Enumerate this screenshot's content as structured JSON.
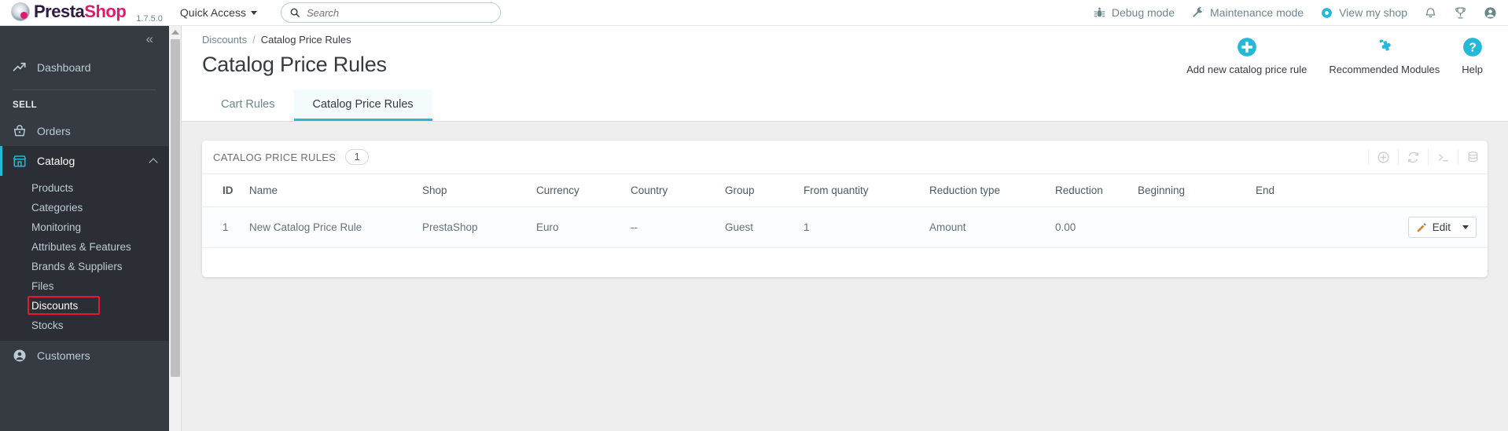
{
  "topbar": {
    "brand_part1": "Presta",
    "brand_part2": "Shop",
    "version": "1.7.5.0",
    "quick_access": "Quick Access",
    "search_placeholder": "Search",
    "search_value": "",
    "links": [
      {
        "label": "Debug mode",
        "icon": "bug-icon"
      },
      {
        "label": "Maintenance mode",
        "icon": "wrench-icon"
      },
      {
        "label": "View my shop",
        "icon": "eye-icon"
      }
    ],
    "icons": [
      {
        "name": "bell-icon"
      },
      {
        "name": "trophy-icon"
      },
      {
        "name": "user-account-icon"
      }
    ]
  },
  "sidebar": {
    "collapse_label": "«",
    "dashboard": {
      "label": "Dashboard",
      "icon": "trend-line-icon"
    },
    "section_sell": "SELL",
    "items": [
      {
        "label": "Orders",
        "icon": "basket-icon",
        "active": false
      },
      {
        "label": "Catalog",
        "icon": "store-icon",
        "active": true
      },
      {
        "label": "Customers",
        "icon": "person-circle-icon",
        "active": false
      }
    ],
    "catalog_submenu": [
      {
        "label": "Products",
        "highlighted": false
      },
      {
        "label": "Categories",
        "highlighted": false
      },
      {
        "label": "Monitoring",
        "highlighted": false
      },
      {
        "label": "Attributes & Features",
        "highlighted": false
      },
      {
        "label": "Brands & Suppliers",
        "highlighted": false
      },
      {
        "label": "Files",
        "highlighted": false
      },
      {
        "label": "Discounts",
        "highlighted": true
      },
      {
        "label": "Stocks",
        "highlighted": false
      }
    ],
    "highlight_color": "#e8192c"
  },
  "page": {
    "breadcrumb_parent": "Discounts",
    "breadcrumb_sep": "/",
    "breadcrumb_current": "Catalog Price Rules",
    "title": "Catalog Price Rules",
    "actions": [
      {
        "label": "Add new catalog price rule",
        "icon": "plus-circle-icon"
      },
      {
        "label": "Recommended Modules",
        "icon": "puzzle-icon"
      },
      {
        "label": "Help",
        "icon": "question-circle-icon"
      }
    ],
    "tabs": [
      {
        "label": "Cart Rules",
        "active": false
      },
      {
        "label": "Catalog Price Rules",
        "active": true
      }
    ]
  },
  "panel": {
    "title": "CATALOG PRICE RULES",
    "count": "1",
    "tools": [
      {
        "name": "add-icon"
      },
      {
        "name": "refresh-icon"
      },
      {
        "name": "sql-terminal-icon"
      },
      {
        "name": "database-export-icon"
      }
    ],
    "columns": [
      "ID",
      "Name",
      "Shop",
      "Currency",
      "Country",
      "Group",
      "From quantity",
      "Reduction type",
      "Reduction",
      "Beginning",
      "End"
    ],
    "rows": [
      {
        "id": "1",
        "name": "New Catalog Price Rule",
        "shop": "PrestaShop",
        "currency": "Euro",
        "country": "--",
        "group": "Guest",
        "from_quantity": "1",
        "reduction_type": "Amount",
        "reduction": "0.00",
        "beginning": "",
        "end": "",
        "action_label": "Edit"
      }
    ]
  },
  "colors": {
    "accent": "#25b9d7",
    "brand_pink": "#e6186e",
    "brand_dark": "#2d1a45",
    "sidebar_bg": "#363a41",
    "highlight_red": "#e8192c"
  }
}
